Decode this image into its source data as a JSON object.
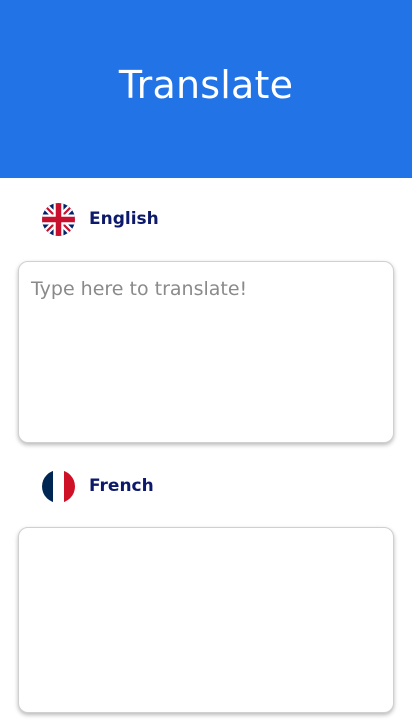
{
  "header": {
    "title": "Translate"
  },
  "source": {
    "language": "English",
    "flag_icon": "uk-flag-icon",
    "input_value": "",
    "placeholder": "Type here to translate!"
  },
  "target": {
    "language": "French",
    "flag_icon": "france-flag-icon",
    "output_value": ""
  },
  "colors": {
    "header_bg": "#2173e6",
    "label_color": "#0d1a6b",
    "header_text": "#ffffff"
  }
}
